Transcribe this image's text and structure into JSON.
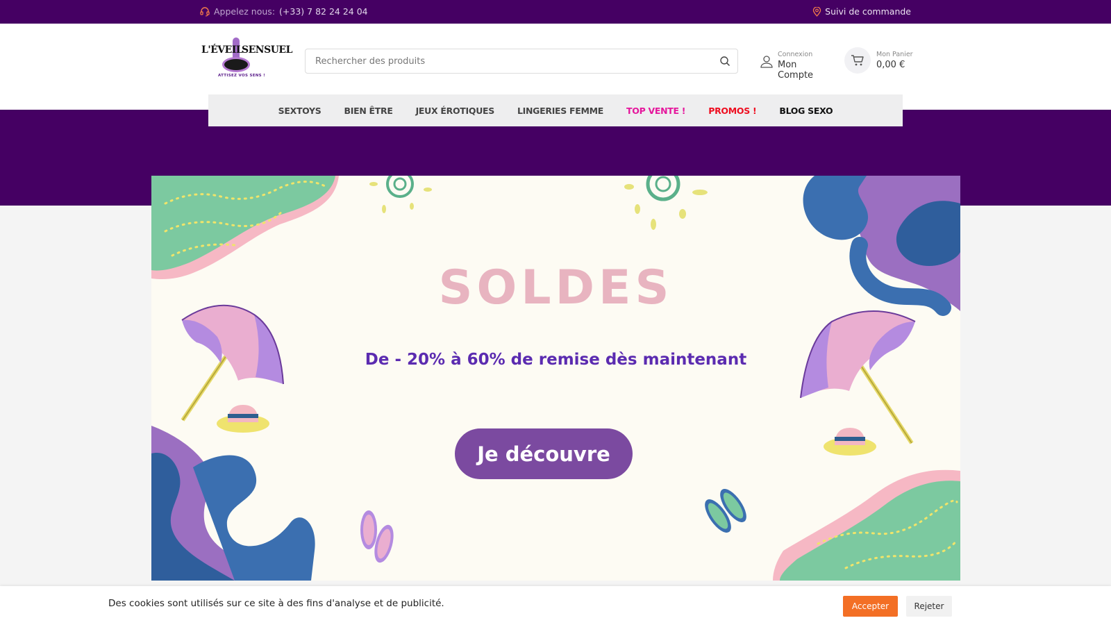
{
  "topbar": {
    "phone_label": "Appelez nous:",
    "phone_number": "(+33) 7 82 24 24 04",
    "track_label": "Suivi de commande"
  },
  "logo": {
    "part1": "L'ÉVEIL",
    "part2": "SENSUEL",
    "tagline": "ATTISEZ VOS SENS !"
  },
  "search": {
    "placeholder": "Rechercher des produits"
  },
  "account": {
    "small": "Connexion",
    "large": "Mon Compte"
  },
  "cart": {
    "small": "Mon Panier",
    "total": "0,00 €"
  },
  "nav": {
    "items": [
      {
        "label": "SEXTOYS",
        "color": "#444444"
      },
      {
        "label": "BIEN ÊTRE",
        "color": "#444444"
      },
      {
        "label": "JEUX ÉROTIQUES",
        "color": "#444444"
      },
      {
        "label": "LINGERIES FEMME",
        "color": "#444444"
      },
      {
        "label": "TOP VENTE !",
        "color": "#e5169c"
      },
      {
        "label": "PROMOS !",
        "color": "#ee0d1f"
      },
      {
        "label": "BLOG SEXO",
        "color": "#111111"
      }
    ]
  },
  "banner": {
    "title": "SOLDES",
    "subtitle": "De - 20% à 60% de remise dès maintenant",
    "cta": "Je découvre"
  },
  "cookie": {
    "message": "Des cookies sont utilisés sur ce site à des fins d'analyse et de publicité.",
    "accept": "Accepter",
    "reject": "Rejeter"
  },
  "colors": {
    "brand_purple": "#450063",
    "accent_orange": "#f36f25",
    "cta_purple": "#7b4aa0",
    "soldes_pink": "#e8b4c0",
    "subtitle_violet": "#5b2bb0"
  }
}
